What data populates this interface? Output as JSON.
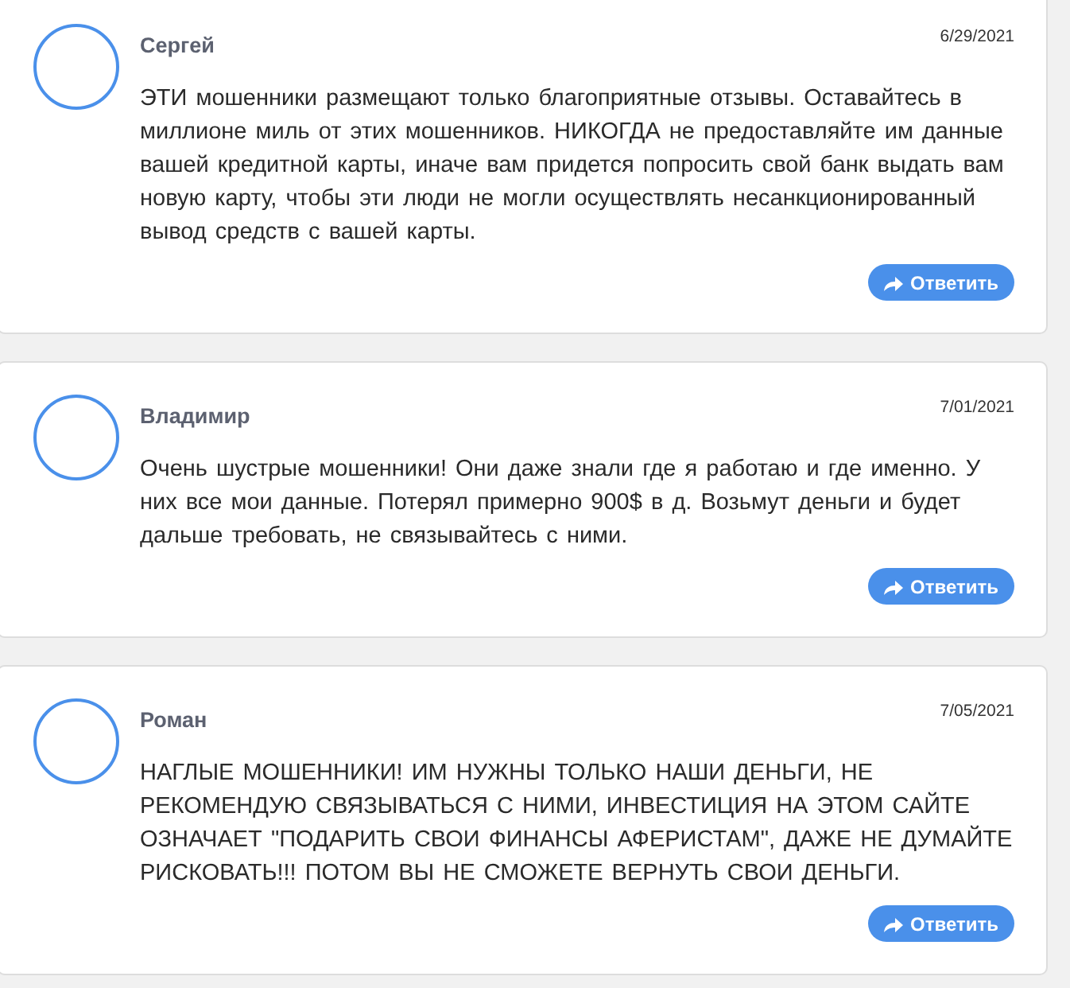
{
  "reviews": [
    {
      "author": "Сергей",
      "date": "6/29/2021",
      "text": "ЭТИ мошенники размещают только благоприятные отзывы. Оставайтесь в миллионе миль от этих мошенников. НИКОГДА не предоставляйте им данные вашей кредитной карты, иначе вам придется попросить свой банк выдать вам новую карту, чтобы эти люди не могли осуществлять несанкционированный вывод средств с вашей карты.",
      "reply_button": "Ответить"
    },
    {
      "author": "Владимир",
      "date": "7/01/2021",
      "text": "Очень шустрые мошенники! Они даже знали где я работаю и где именно. У них все мои данные. Потерял примерно 900$ в д. Возьмут деньги и будет дальше требовать, не связывайтесь с ними.",
      "reply_button": "Ответить"
    },
    {
      "author": "Роман",
      "date": "7/05/2021",
      "text": "НАГЛЫЕ МОШЕННИКИ! ИМ НУЖНЫ ТОЛЬКО НАШИ ДЕНЬГИ, НЕ РЕКОМЕНДУЮ СВЯЗЫВАТЬСЯ С НИМИ, ИНВЕСТИЦИЯ НА ЭТОМ САЙТЕ ОЗНАЧАЕТ \"ПОДАРИТЬ СВОИ ФИНАНСЫ АФЕРИСТАМ\", ДАЖЕ НЕ ДУМАЙТЕ РИСКОВАТЬ!!! ПОТОМ ВЫ НЕ СМОЖЕТЕ ВЕРНУТЬ СВОИ ДЕНЬГИ.",
      "reply_button": "Ответить"
    }
  ]
}
